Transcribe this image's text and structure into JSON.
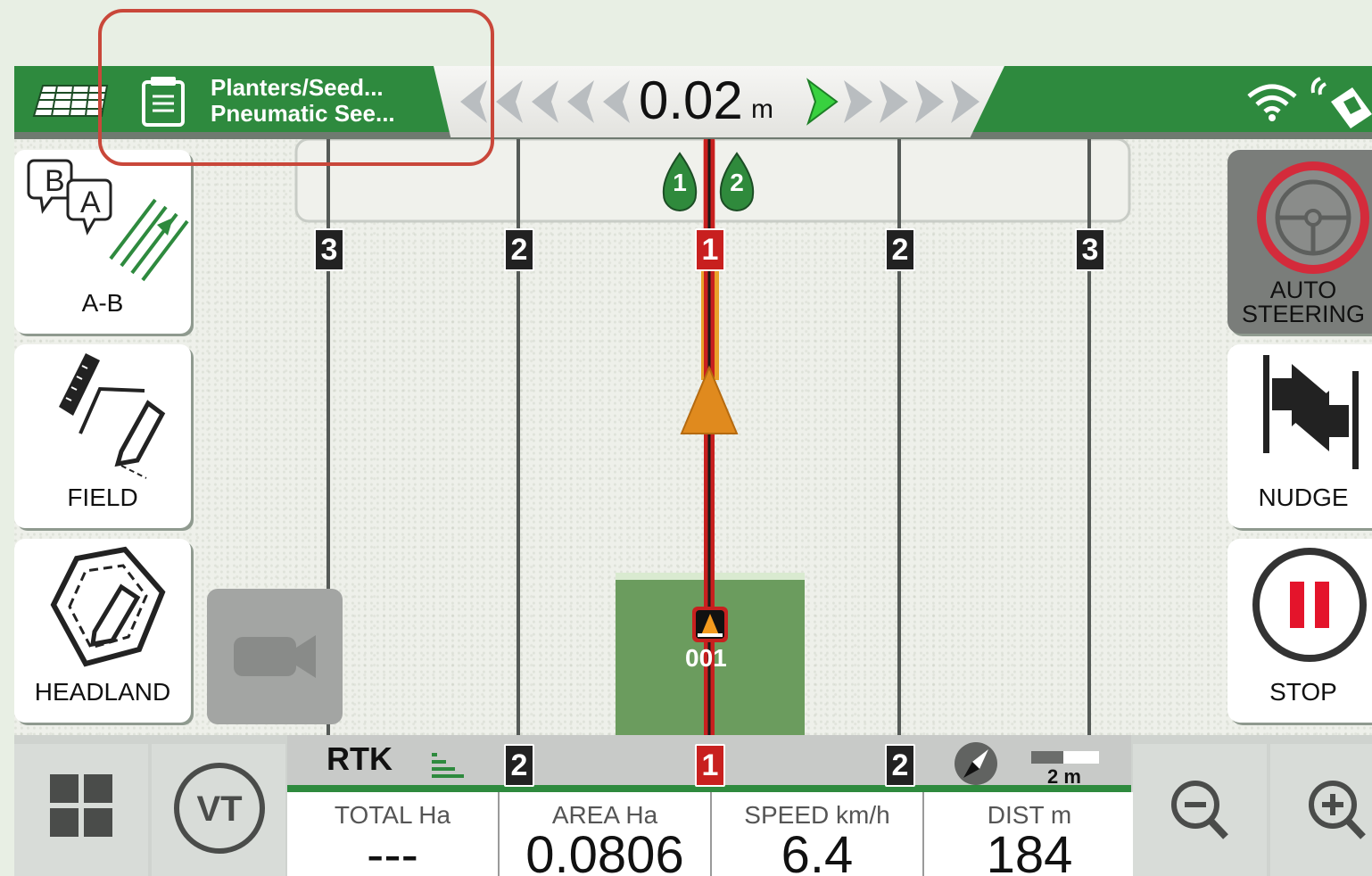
{
  "topbar": {
    "implement_line1": "Planters/Seed...",
    "implement_line2": "Pneumatic See...",
    "cross_track_value": "0.02",
    "cross_track_unit": "m"
  },
  "map": {
    "lanes": [
      "3",
      "2",
      "1",
      "2",
      "3"
    ],
    "bottom_lanes": [
      "2",
      "1",
      "2"
    ],
    "seed_sections": [
      "1",
      "2"
    ],
    "section_id": "001"
  },
  "left_buttons": {
    "ab_label": "A-B",
    "ab_letter_b": "B",
    "ab_letter_a": "A",
    "field_label": "FIELD",
    "headland_label": "HEADLAND"
  },
  "right_buttons": {
    "auto_steering_line1": "AUTO",
    "auto_steering_line2": "STEERING",
    "nudge_label": "NUDGE",
    "stop_label": "STOP"
  },
  "bottom": {
    "vt_label": "VT",
    "rtk_label": "RTK",
    "scale_label": "2 m",
    "stats": [
      {
        "label": "TOTAL Ha",
        "value": "---"
      },
      {
        "label": "AREA Ha",
        "value": "0.0806"
      },
      {
        "label": "SPEED km/h",
        "value": "6.4"
      },
      {
        "label": "DIST m",
        "value": "184"
      }
    ]
  },
  "colors": {
    "brand_green": "#2e8a3e",
    "guidance_red": "#c8201f",
    "vehicle_orange": "#e08a1e",
    "coverage_green": "#6b9c5e"
  }
}
